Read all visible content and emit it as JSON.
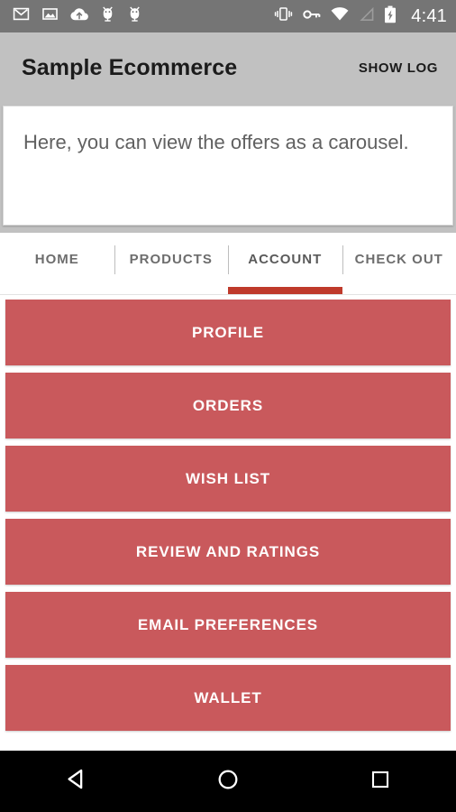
{
  "status_bar": {
    "background": "#757575",
    "time": "4:41",
    "left_icons": [
      {
        "name": "gmail-icon",
        "label": "Gmail"
      },
      {
        "name": "screenshot-image-icon",
        "label": "Screenshot"
      },
      {
        "name": "cloud-upload-icon",
        "label": "Cloud upload"
      },
      {
        "name": "android-debug-icon",
        "label": "USB debugging"
      },
      {
        "name": "android-debug-icon-2",
        "label": "USB debugging"
      }
    ],
    "right_icons": [
      {
        "name": "vibrate-icon",
        "label": "Vibrate mode"
      },
      {
        "name": "vpn-key-icon",
        "label": "VPN"
      },
      {
        "name": "wifi-icon",
        "label": "Wi-Fi full"
      },
      {
        "name": "signal-icon",
        "label": "No signal"
      },
      {
        "name": "battery-charging-icon",
        "label": "Battery charging"
      }
    ]
  },
  "app_bar": {
    "background": "#c1c1c1",
    "title": "Sample Ecommerce",
    "action_label": "SHOW LOG"
  },
  "carousel_card": {
    "text": "Here, you can view the offers as a carousel."
  },
  "tabs": {
    "selected_index": 2,
    "indicator_color": "#bf3a2b",
    "items": [
      {
        "label": "HOME"
      },
      {
        "label": "PRODUCTS"
      },
      {
        "label": "ACCOUNT"
      },
      {
        "label": "CHECK OUT"
      }
    ]
  },
  "account_menu": {
    "button_color": "#c9595c",
    "buttons": [
      {
        "label": "PROFILE"
      },
      {
        "label": "ORDERS"
      },
      {
        "label": "WISH LIST"
      },
      {
        "label": "REVIEW AND RATINGS"
      },
      {
        "label": "EMAIL PREFERENCES"
      },
      {
        "label": "WALLET"
      }
    ]
  },
  "nav_bar": {
    "background": "#000000",
    "buttons": [
      {
        "name": "back-icon",
        "label": "Back"
      },
      {
        "name": "home-icon",
        "label": "Home"
      },
      {
        "name": "recents-icon",
        "label": "Recents"
      }
    ]
  }
}
